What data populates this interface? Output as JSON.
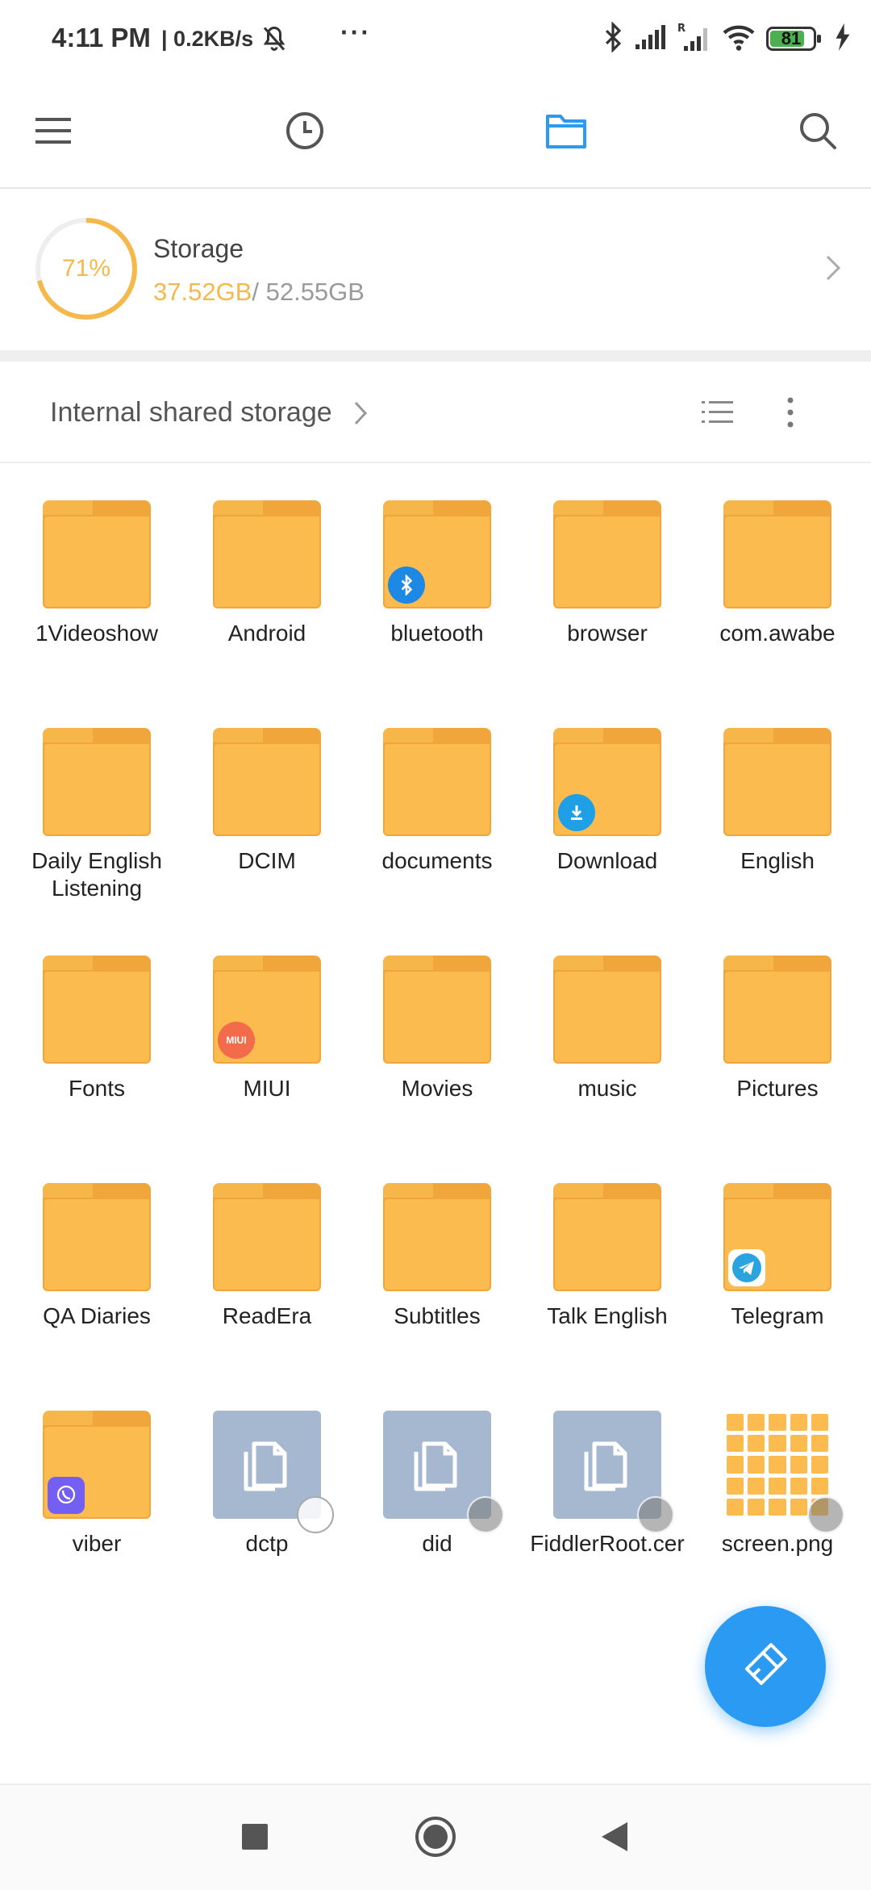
{
  "status_bar": {
    "time": "4:11 PM",
    "speed": "| 0.2KB/s",
    "more": "···",
    "battery_level": "81",
    "battery_fraction": 0.81
  },
  "toolbar": {
    "icons": [
      "menu-icon",
      "recent-clock-icon",
      "folder-icon",
      "search-icon"
    ],
    "accent": "#2b9af3"
  },
  "storage": {
    "percent_label": "71%",
    "percent": 71,
    "title": "Storage",
    "used": "37.52GB",
    "total": "/ 52.55GB",
    "accent": "#f5b84a"
  },
  "path": {
    "label": "Internal shared storage"
  },
  "items": [
    {
      "name": "1Videoshow",
      "type": "folder",
      "badge": ""
    },
    {
      "name": "Android",
      "type": "folder",
      "badge": ""
    },
    {
      "name": "bluetooth",
      "type": "folder",
      "badge": "bluetooth"
    },
    {
      "name": "browser",
      "type": "folder",
      "badge": ""
    },
    {
      "name": "com.awabe",
      "type": "folder",
      "badge": ""
    },
    {
      "name": "Daily English Listening",
      "type": "folder",
      "badge": ""
    },
    {
      "name": "DCIM",
      "type": "folder",
      "badge": ""
    },
    {
      "name": "documents",
      "type": "folder",
      "badge": ""
    },
    {
      "name": "Download",
      "type": "folder",
      "badge": "download"
    },
    {
      "name": "English",
      "type": "folder",
      "badge": ""
    },
    {
      "name": "Fonts",
      "type": "folder",
      "badge": ""
    },
    {
      "name": "MIUI",
      "type": "folder",
      "badge": "miui"
    },
    {
      "name": "Movies",
      "type": "folder",
      "badge": ""
    },
    {
      "name": "music",
      "type": "folder",
      "badge": ""
    },
    {
      "name": "Pictures",
      "type": "folder",
      "badge": ""
    },
    {
      "name": "QA Diaries",
      "type": "folder",
      "badge": ""
    },
    {
      "name": "ReadEra",
      "type": "folder",
      "badge": ""
    },
    {
      "name": "Subtitles",
      "type": "folder",
      "badge": ""
    },
    {
      "name": "Talk English",
      "type": "folder",
      "badge": ""
    },
    {
      "name": "Telegram",
      "type": "folder",
      "badge": "telegram"
    },
    {
      "name": "viber",
      "type": "folder",
      "badge": "viber"
    },
    {
      "name": "dctp",
      "type": "file",
      "badge": ""
    },
    {
      "name": "did",
      "type": "file",
      "badge": ""
    },
    {
      "name": "FiddlerRoot.cer",
      "type": "file",
      "badge": ""
    },
    {
      "name": "screen.png",
      "type": "image",
      "badge": ""
    }
  ],
  "badge_texts": {
    "miui": "MIUI"
  },
  "fab": {
    "icon": "cleaner-brush-icon"
  },
  "nav": {
    "icons": [
      "recents-square-icon",
      "home-circle-icon",
      "back-triangle-icon"
    ]
  }
}
